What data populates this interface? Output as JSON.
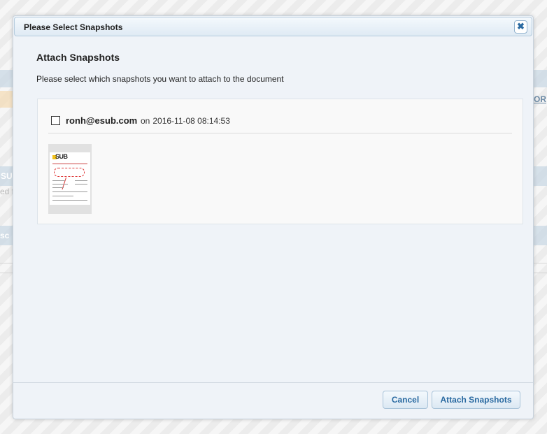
{
  "dialog": {
    "title": "Please Select Snapshots",
    "close_glyph": "✖",
    "heading": "Attach Snapshots",
    "instructions": "Please select which snapshots you want to attach to the document"
  },
  "snapshots": [
    {
      "user": "ronh@esub.com",
      "on_label": "on",
      "date": "2016-11-08 08:14:53",
      "checked": false,
      "thumbnail_logo": "SUB"
    }
  ],
  "buttons": {
    "cancel": "Cancel",
    "attach": "Attach Snapshots"
  },
  "background_fragments": {
    "right_label": "OR",
    "left_label_1": "SU",
    "left_label_2": "ed fi",
    "left_label_3": "sc"
  }
}
